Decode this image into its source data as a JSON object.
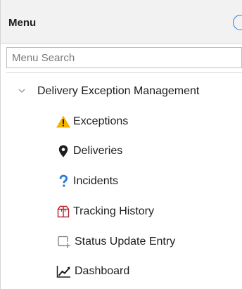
{
  "menu": {
    "title": "Menu",
    "search": {
      "placeholder": "Menu Search",
      "value": ""
    },
    "tree": {
      "label": "Delivery Exception Management",
      "expanded": true,
      "items": [
        {
          "label": "Exceptions",
          "icon": "warning-icon"
        },
        {
          "label": "Deliveries",
          "icon": "map-pin-icon"
        },
        {
          "label": "Incidents",
          "icon": "question-icon"
        },
        {
          "label": "Tracking History",
          "icon": "package-icon"
        },
        {
          "label": "Status Update Entry",
          "icon": "add-entry-icon"
        },
        {
          "label": "Dashboard",
          "icon": "trend-chart-icon"
        }
      ]
    }
  },
  "colors": {
    "header_bg": "#f2f2f2",
    "accent_blue": "#2a7ad2",
    "warning_yellow": "#f5b301",
    "package_red": "#b0202d"
  }
}
